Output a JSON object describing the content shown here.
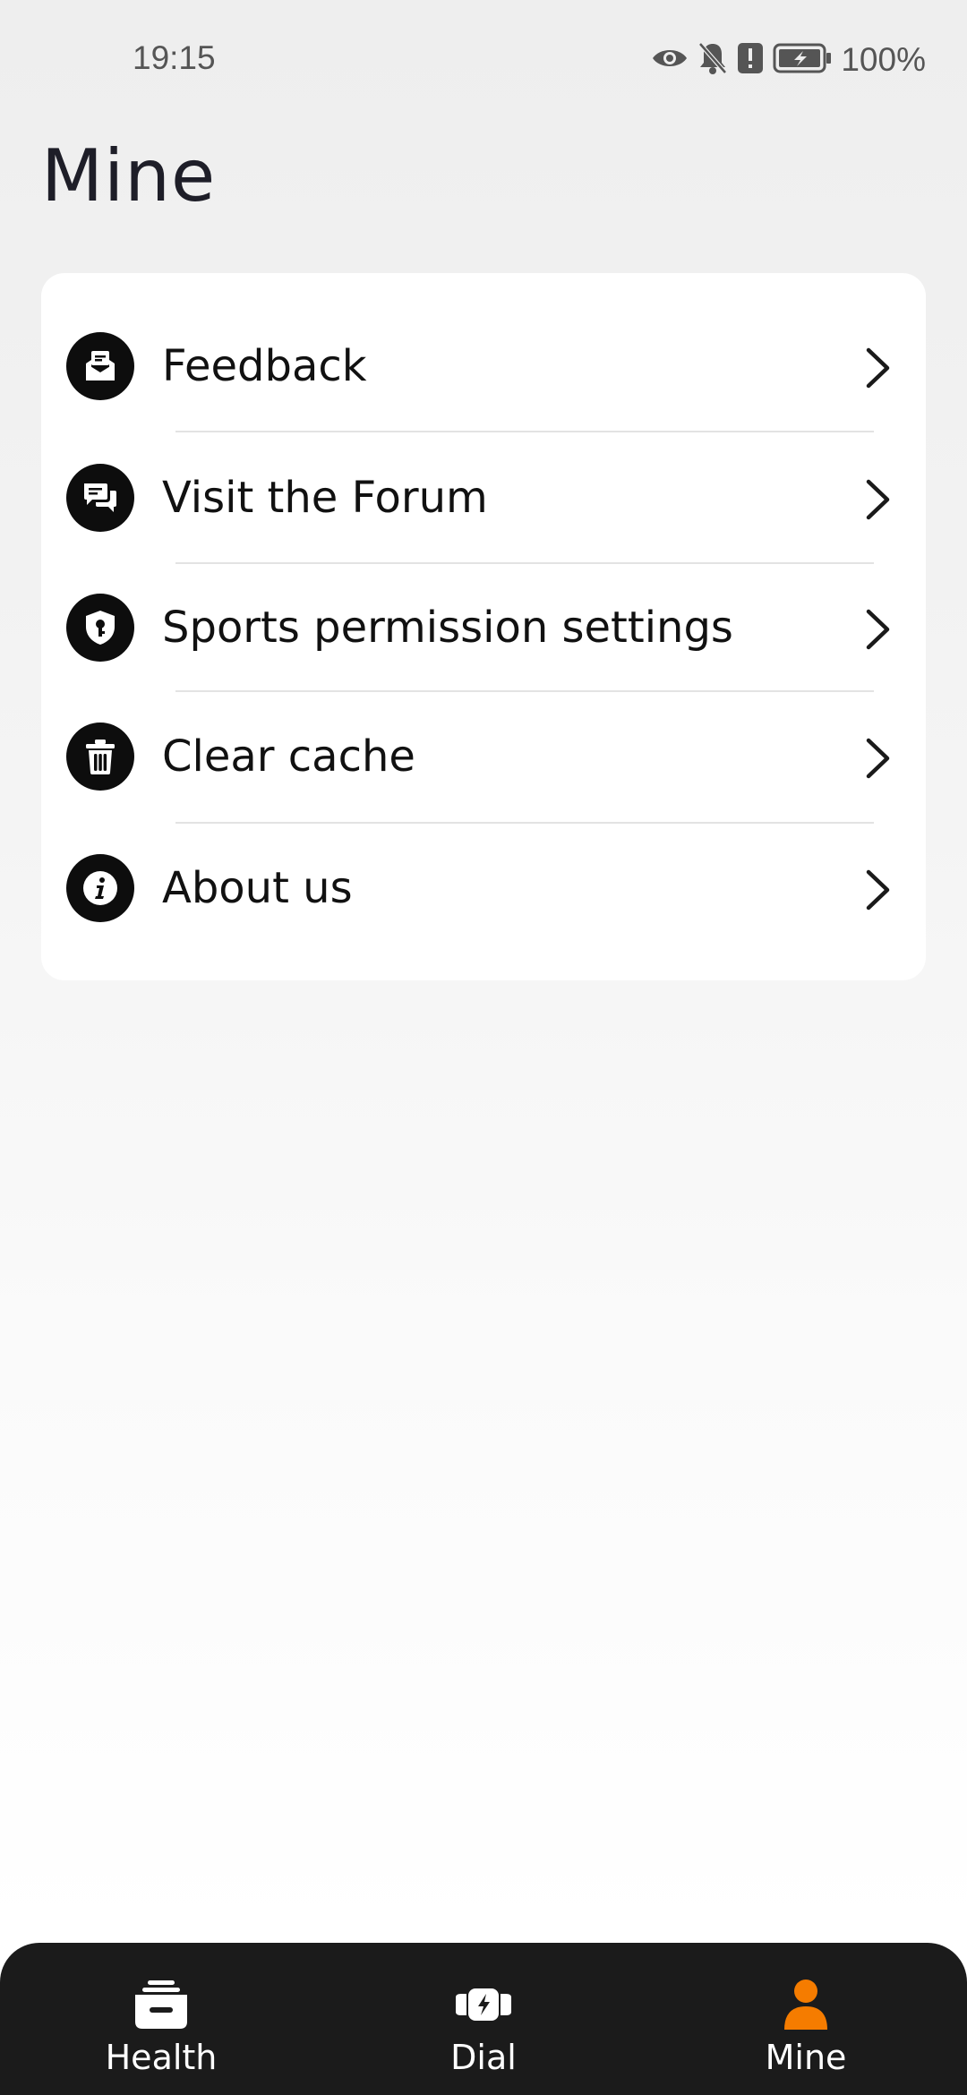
{
  "status_bar": {
    "time": "19:15",
    "battery_percent": "100%",
    "icons": [
      "eye-icon",
      "bell-off-icon",
      "alert-icon",
      "battery-charging-icon"
    ]
  },
  "page": {
    "title": "Mine"
  },
  "menu": {
    "items": [
      {
        "label": "Feedback",
        "icon": "feedback-mail-icon"
      },
      {
        "label": "Visit the Forum",
        "icon": "forum-chat-icon"
      },
      {
        "label": "Sports permission settings",
        "icon": "shield-lock-icon"
      },
      {
        "label": "Clear cache",
        "icon": "trash-icon"
      },
      {
        "label": "About us",
        "icon": "info-icon"
      }
    ]
  },
  "bottom_nav": {
    "tabs": [
      {
        "label": "Health",
        "icon": "health-stack-icon",
        "active": false
      },
      {
        "label": "Dial",
        "icon": "watch-dial-icon",
        "active": false
      },
      {
        "label": "Mine",
        "icon": "person-icon",
        "active": true
      }
    ],
    "active_color": "#F57C00",
    "inactive_color": "#FFFFFF"
  }
}
